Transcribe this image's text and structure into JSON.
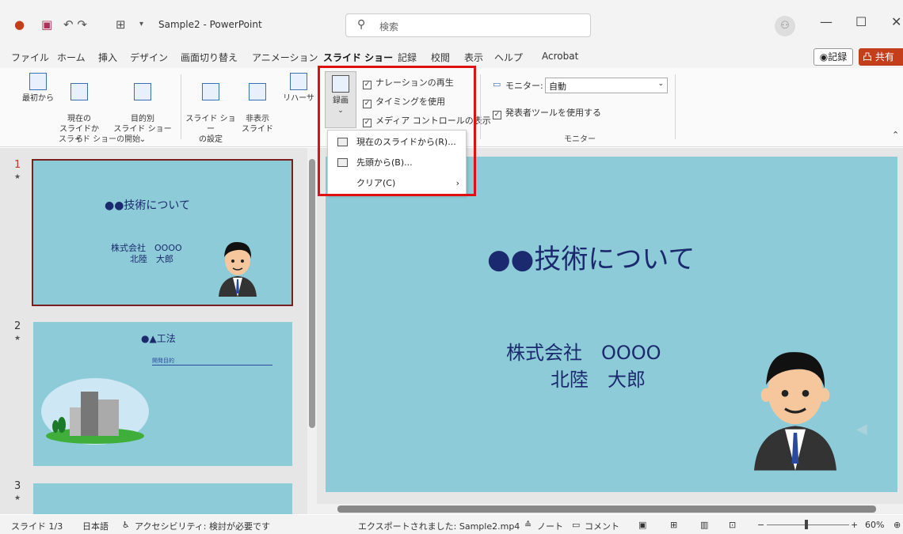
{
  "app": {
    "title": "Sample2 - PowerPoint",
    "search_placeholder": "検索",
    "quick_access_glyphs": "↶ ↷"
  },
  "menu": {
    "items": [
      "ファイル",
      "ホーム",
      "挿入",
      "デザイン",
      "画面切り替え",
      "アニメーション",
      "スライド ショー",
      "記録",
      "校閲",
      "表示",
      "ヘルプ",
      "Acrobat"
    ],
    "active": "スライド ショー",
    "record_button": "◉記録",
    "share_button": "凸 共有"
  },
  "ribbon": {
    "buttons": {
      "from_beginning": "最初から",
      "from_current": "現在の\nスライドから",
      "custom": "目的別\nスライド ショー ⌄",
      "setup": "スライド ショー\nの設定",
      "hide": "非表示\nスライド",
      "rehearse": "リハーサ",
      "record": "録画"
    },
    "group_start_label": "スライド ショーの開始",
    "group_monitor_label": "モニター",
    "checkboxes": [
      "ナレーションの再生",
      "タイミングを使用",
      "メディア コントロールの表示"
    ],
    "monitor_label": "モニター:",
    "monitor_value": "自動",
    "presenter_view": "発表者ツールを使用する"
  },
  "dropdown": {
    "items": [
      "現在のスライドから(R)...",
      "先頭から(B)...",
      "クリア(C)"
    ]
  },
  "thumbnails": [
    {
      "num": "1",
      "title": "●●技術について",
      "company": "株式会社　OOOO",
      "name": "北陸　大郎"
    },
    {
      "num": "2",
      "title": "●▲工法",
      "subtitle": "開発目的"
    },
    {
      "num": "3"
    }
  ],
  "slide": {
    "title": "●●技術について",
    "company": "株式会社　OOOO",
    "name": "北陸　大郎"
  },
  "status": {
    "slide_pos": "スライド 1/3",
    "language": "日本語",
    "accessibility": "アクセシビリティ: 検討が必要です",
    "export": "エクスポートされました: Sample2.mp4",
    "notes": "ノート",
    "comments": "コメント",
    "zoom": "60%"
  },
  "colors": {
    "slide_bg": "#8ecbd8",
    "title_color": "#1b2a6e",
    "accent_red": "#e01010",
    "share_bg": "#c43e1c"
  }
}
